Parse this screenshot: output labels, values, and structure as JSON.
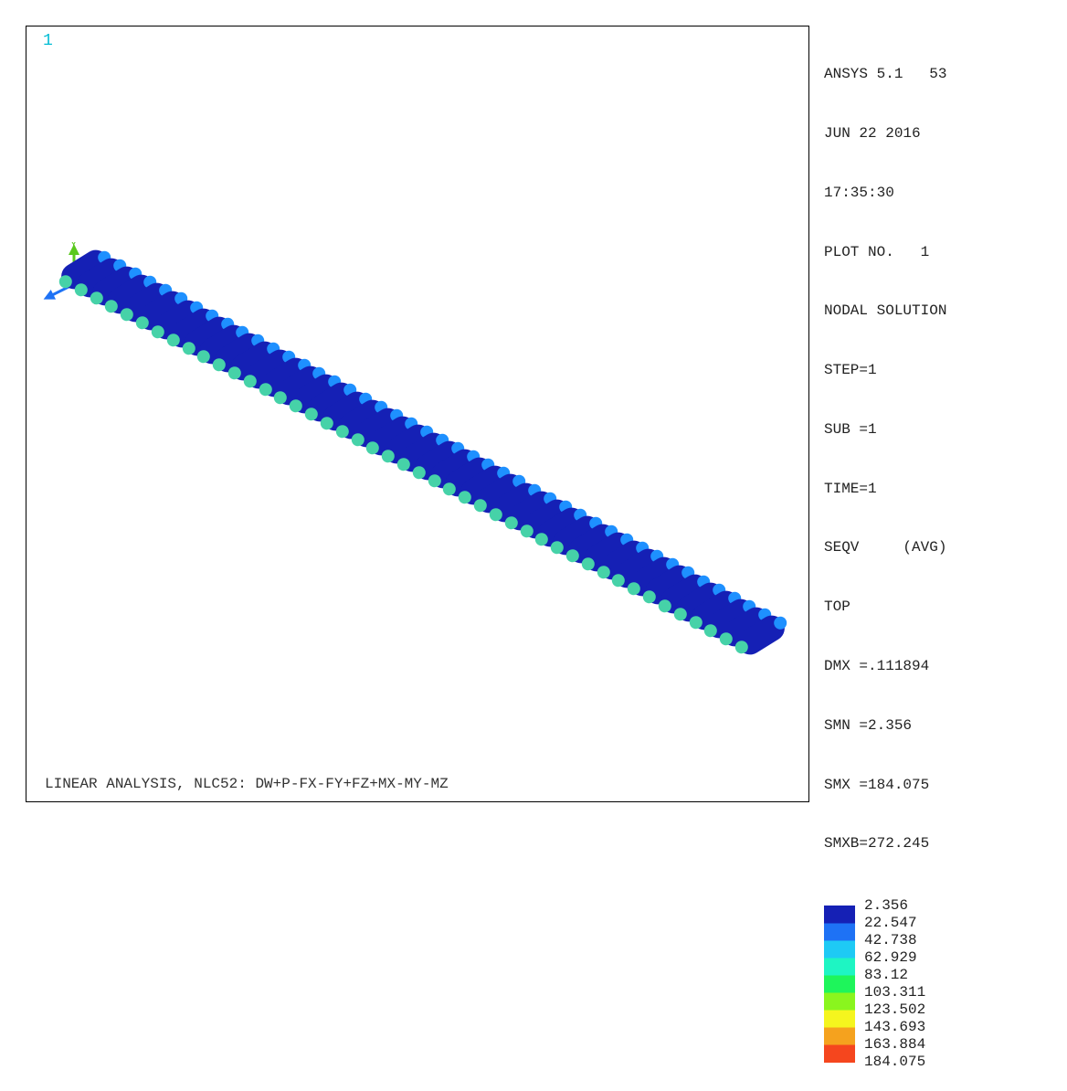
{
  "window_number": "1",
  "caption": "LINEAR ANALYSIS, NLC52: DW+P-FX-FY+FZ+MX-MY-MZ",
  "info": {
    "software": "ANSYS 5.1   53",
    "date": "JUN 22 2016",
    "time": "17:35:30",
    "plot_no": "PLOT NO.   1",
    "solution": "NODAL SOLUTION",
    "step": "STEP=1",
    "sub": "SUB =1",
    "time_k": "TIME=1",
    "seqv": "SEQV     (AVG)",
    "top": "TOP",
    "dmx": "DMX =.111894",
    "smn": "SMN =2.356",
    "smx": "SMX =184.075",
    "smxb": "SMXB=272.245"
  },
  "legend": [
    {
      "color": "#1520b5",
      "value": "2.356"
    },
    {
      "color": "#1e72f5",
      "value": "22.547"
    },
    {
      "color": "#1ecaf5",
      "value": "42.738"
    },
    {
      "color": "#1ef5c3",
      "value": "62.929"
    },
    {
      "color": "#1ef55b",
      "value": "83.12"
    },
    {
      "color": "#8af51e",
      "value": "103.311"
    },
    {
      "color": "#f5f51e",
      "value": "123.502"
    },
    {
      "color": "#f5a21e",
      "value": "143.693"
    },
    {
      "color": "#f5461e",
      "value": "163.884"
    },
    {
      "value": "184.075"
    }
  ],
  "axes": {
    "x": "X",
    "y": "Y"
  }
}
